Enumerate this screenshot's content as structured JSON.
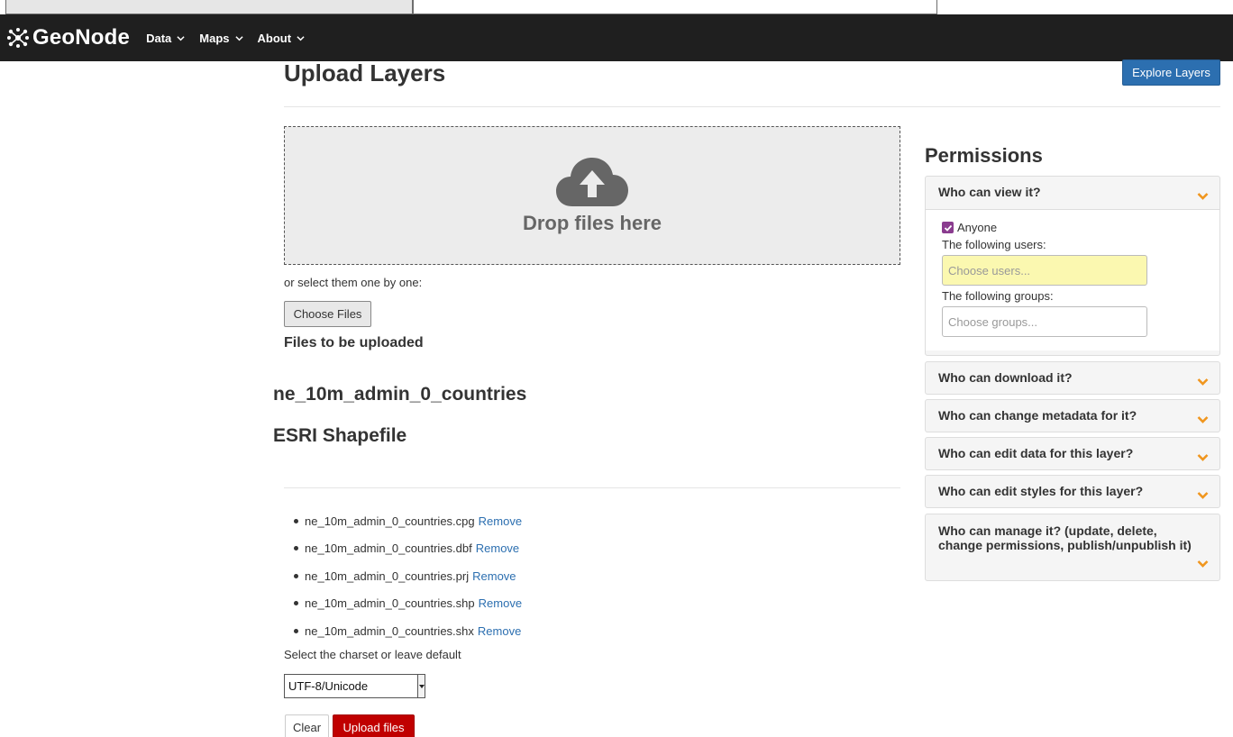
{
  "navbar": {
    "brand": "GeoNode",
    "items": [
      {
        "label": "Data"
      },
      {
        "label": "Maps"
      },
      {
        "label": "About"
      }
    ]
  },
  "header": {
    "title": "Upload Layers",
    "explore_button": "Explore Layers"
  },
  "dropzone": {
    "text": "Drop files here"
  },
  "upload": {
    "select_text": "or select them one by one:",
    "choose_files_label": "Choose Files",
    "files_heading": "Files to be uploaded",
    "layer_name": "ne_10m_admin_0_countries",
    "layer_type": "ESRI Shapefile",
    "files": [
      {
        "name": "ne_10m_admin_0_countries.cpg",
        "action": "Remove"
      },
      {
        "name": "ne_10m_admin_0_countries.dbf",
        "action": "Remove"
      },
      {
        "name": "ne_10m_admin_0_countries.prj",
        "action": "Remove"
      },
      {
        "name": "ne_10m_admin_0_countries.shp",
        "action": "Remove"
      },
      {
        "name": "ne_10m_admin_0_countries.shx",
        "action": "Remove"
      }
    ],
    "charset_label": "Select the charset or leave default",
    "charset_value": "UTF-8/Unicode",
    "clear_label": "Clear",
    "upload_label": "Upload files"
  },
  "permissions": {
    "title": "Permissions",
    "view": {
      "heading": "Who can view it?",
      "anyone_label": "Anyone",
      "users_label": "The following users:",
      "users_placeholder": "Choose users...",
      "groups_label": "The following groups:",
      "groups_placeholder": "Choose groups..."
    },
    "panels": [
      {
        "heading": "Who can download it?"
      },
      {
        "heading": "Who can change metadata for it?"
      },
      {
        "heading": "Who can edit data for this layer?"
      },
      {
        "heading": "Who can edit styles for this layer?"
      },
      {
        "heading": "Who can manage it? (update, delete, change permissions, publish/unpublish it)"
      }
    ]
  },
  "colors": {
    "navbar": "#1f1f1f",
    "primary": "#2c6fb0",
    "danger": "#c00000",
    "accent_chevron": "#f0961e",
    "checkbox": "#8a3c8f"
  }
}
